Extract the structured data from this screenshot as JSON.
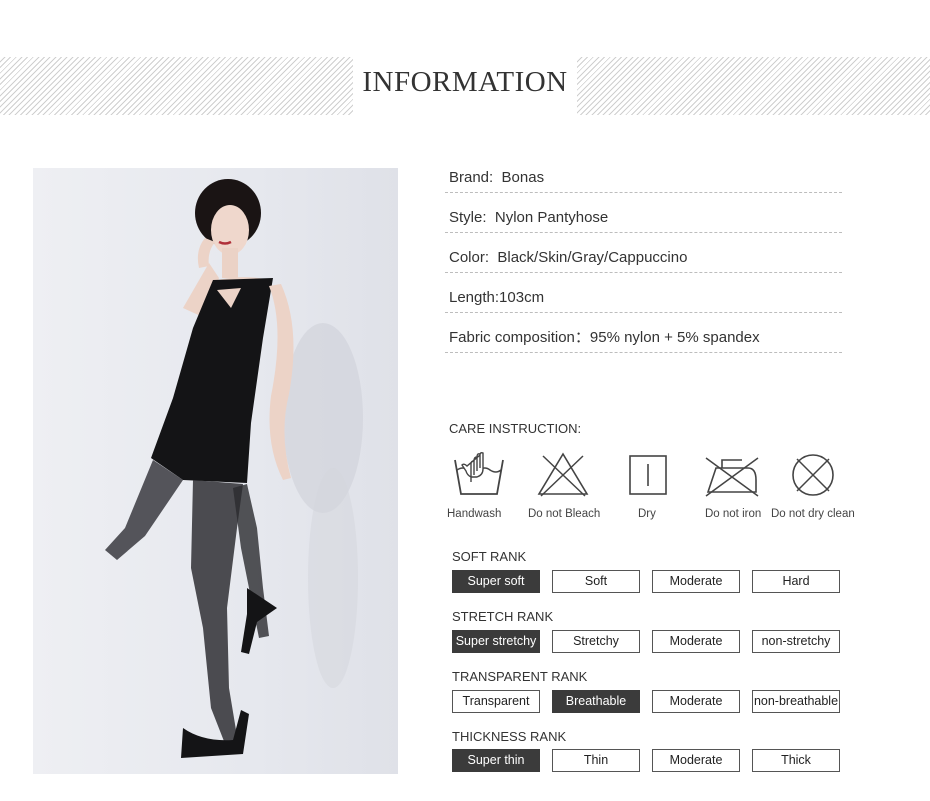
{
  "header": {
    "title": "INFORMATION"
  },
  "specs": [
    {
      "label": "Brand:",
      "value": "Bonas"
    },
    {
      "label": "Style:",
      "value": "Nylon Pantyhose"
    },
    {
      "label": "Color:",
      "value": "Black/Skin/Gray/Cappuccino"
    },
    {
      "label": "Length:",
      "value": "103cm"
    },
    {
      "label": "Fabric composition：",
      "value": "95% nylon + 5% spandex"
    }
  ],
  "care": {
    "title": "CARE INSTRUCTION:",
    "items": [
      {
        "icon": "handwash-icon",
        "label": "Handwash"
      },
      {
        "icon": "do-not-bleach-icon",
        "label": "Do not Bleach"
      },
      {
        "icon": "dry-icon",
        "label": "Dry"
      },
      {
        "icon": "do-not-iron-icon",
        "label": "Do not iron"
      },
      {
        "icon": "do-not-dry-clean-icon",
        "label": "Do not dry clean"
      }
    ]
  },
  "ranks": [
    {
      "title": "SOFT RANK",
      "options": [
        "Super soft",
        "Soft",
        "Moderate",
        "Hard"
      ],
      "selected": 0
    },
    {
      "title": "STRETCH RANK",
      "options": [
        "Super stretchy",
        "Stretchy",
        "Moderate",
        "non-stretchy"
      ],
      "selected": 0
    },
    {
      "title": "TRANSPARENT RANK",
      "options": [
        "Transparent",
        "Breathable",
        "Moderate",
        "non-breathable"
      ],
      "selected": 1
    },
    {
      "title": "THICKNESS RANK",
      "options": [
        "Super thin",
        "Thin",
        "Moderate",
        "Thick"
      ],
      "selected": 0
    }
  ],
  "colors": {
    "selected_bg": "#3b3b3b",
    "dress": "#141416",
    "legs": "#2a2a2e"
  }
}
